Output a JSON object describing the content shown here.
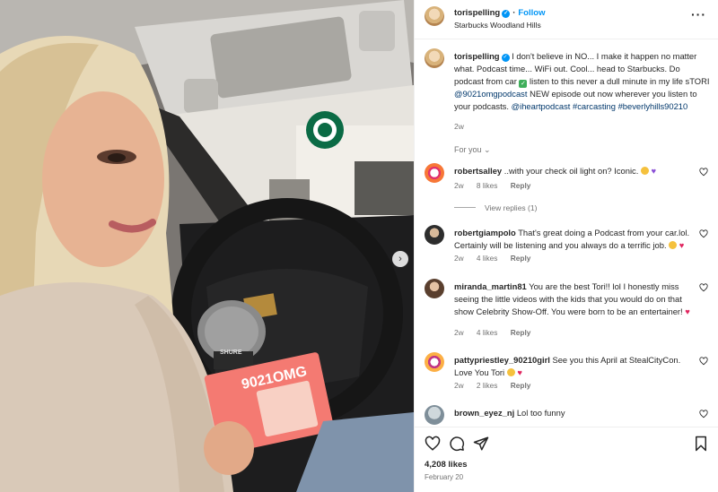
{
  "post": {
    "username": "torispelling",
    "follow_label": "Follow",
    "location": "Starbucks Woodland Hills",
    "more_icon": "more-options-icon",
    "caption": {
      "username": "torispelling",
      "text_1": "I don't believe in NO... I make it happen no matter what. Podcast time... WiFi out. Cool... head to Starbucks. Do podcast from car",
      "text_2": "listen to this never a dull minute in my life sTORI",
      "mention_1": "@9021omgpodcast",
      "text_3": "NEW episode out now wherever you listen to your podcasts.",
      "mention_2": "@iheartpodcast",
      "tag_1": "#carcasting",
      "tag_2": "#beverlyhills90210",
      "time": "2w"
    },
    "for_you_label": "For you"
  },
  "comments": [
    {
      "username": "robertsalley",
      "text": "..with your check oil light on? Iconic.",
      "time": "2w",
      "likes": "8 likes",
      "reply": "Reply",
      "view_replies": "View replies (1)"
    },
    {
      "username": "robertgiampolo",
      "text": "That's great doing a Podcast from your car.lol. Certainly will be listening and you always do a terrific job.",
      "time": "2w",
      "likes": "4 likes",
      "reply": "Reply"
    },
    {
      "username": "miranda_martin81",
      "text": "You are the best Tori!! lol I honestly miss seeing the little videos with the kids that you would do on that show Celebrity Show-Off. You were born to be an entertainer!",
      "time": "2w",
      "likes": "4 likes",
      "reply": "Reply"
    },
    {
      "username": "pattypriestley_90210girl",
      "text": "See you this April at StealCityCon. Love You Tori",
      "time": "2w",
      "likes": "2 likes",
      "reply": "Reply"
    },
    {
      "username": "brown_eyez_nj",
      "text": "Lol too funny"
    }
  ],
  "footer": {
    "likes": "4,208 likes",
    "date": "February 20"
  },
  "photo": {
    "mic_flag_text": "9021OMG",
    "mic_brand": "SHURE"
  },
  "colors": {
    "accent": "#0095f6",
    "link": "#00376b",
    "muted": "#737373",
    "heart": "#e0245e"
  }
}
